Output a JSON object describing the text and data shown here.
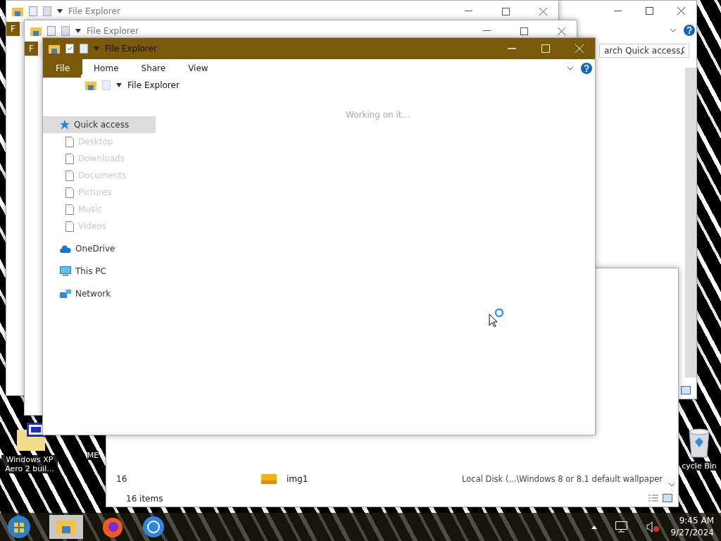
{
  "background_window": {
    "search": {
      "value": "arch Quick access"
    }
  },
  "list_window": {
    "partial_text": "16",
    "rows": [
      {
        "name": "img1",
        "location": "Local Disk (...\\Windows 8 or 8.1 default wallpaper"
      }
    ],
    "status": "16 items"
  },
  "stacked_windows": [
    {
      "title": "File Explorer",
      "ribbon_tab": "F"
    },
    {
      "title": "File Explorer",
      "ribbon_tab": "F"
    }
  ],
  "active_window": {
    "title": "File Explorer",
    "tabs": [
      {
        "label": "File",
        "selected": true
      },
      {
        "label": "Home",
        "selected": false
      },
      {
        "label": "Share",
        "selected": false
      },
      {
        "label": "View",
        "selected": false
      }
    ],
    "nav": [
      {
        "label": "Quick access",
        "kind": "star",
        "selected": true,
        "children": [
          {
            "label": "Desktop",
            "kind": "page",
            "selected": false
          },
          {
            "label": "Downloads",
            "kind": "page",
            "selected": false
          },
          {
            "label": "Documents",
            "kind": "page",
            "selected": false
          },
          {
            "label": "Pictures",
            "kind": "page",
            "selected": false
          },
          {
            "label": "Music",
            "kind": "page",
            "selected": false
          },
          {
            "label": "Videos",
            "kind": "page",
            "selected": false
          }
        ]
      },
      {
        "label": "OneDrive",
        "kind": "cloud",
        "selected": false
      },
      {
        "label": "This PC",
        "kind": "pc",
        "selected": false
      },
      {
        "label": "Network",
        "kind": "network",
        "selected": false
      }
    ],
    "inner_window": {
      "title": "File Explorer",
      "status": "Working on it..."
    }
  },
  "desktop_icons": [
    {
      "label": "Windows XP Aero 2 buil...",
      "kind": "iso"
    },
    {
      "label": "ME",
      "kind": "none"
    },
    {
      "label": "cycle Bin",
      "kind": "bin"
    }
  ],
  "taskbar": {
    "time": "9:45 AM",
    "date": "9/27/2024"
  }
}
